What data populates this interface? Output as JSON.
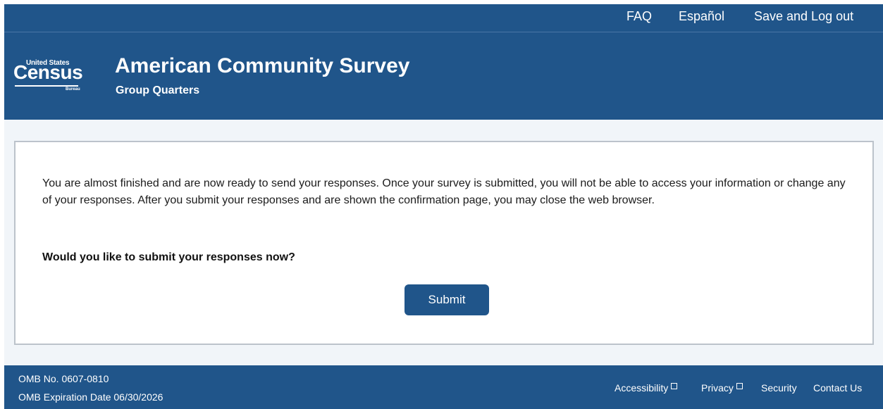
{
  "header": {
    "nav": {
      "faq": "FAQ",
      "espanol": "Español",
      "save_logout": "Save and Log out"
    },
    "logo": {
      "top_line": "United States",
      "word": "Census",
      "bottom_line": "Bureau"
    },
    "title": "American Community Survey",
    "subtitle": "Group Quarters"
  },
  "main": {
    "message": "You are almost finished and are now ready to send your responses. Once your survey is submitted, you will not be able to access your information or change any of your responses. After you submit your responses and are shown the confirmation page, you may close the web browser.",
    "question": "Would you like to submit your responses now?",
    "submit_label": "Submit"
  },
  "footer": {
    "omb_number": "OMB No. 0607-0810",
    "omb_expiration": "OMB Expiration Date 06/30/2026",
    "links": {
      "accessibility": "Accessibility",
      "privacy": "Privacy",
      "security": "Security",
      "contact": "Contact Us"
    }
  },
  "colors": {
    "brand_blue": "#20558a",
    "content_background": "#f1f5f9",
    "card_border": "#bcc3cb"
  }
}
